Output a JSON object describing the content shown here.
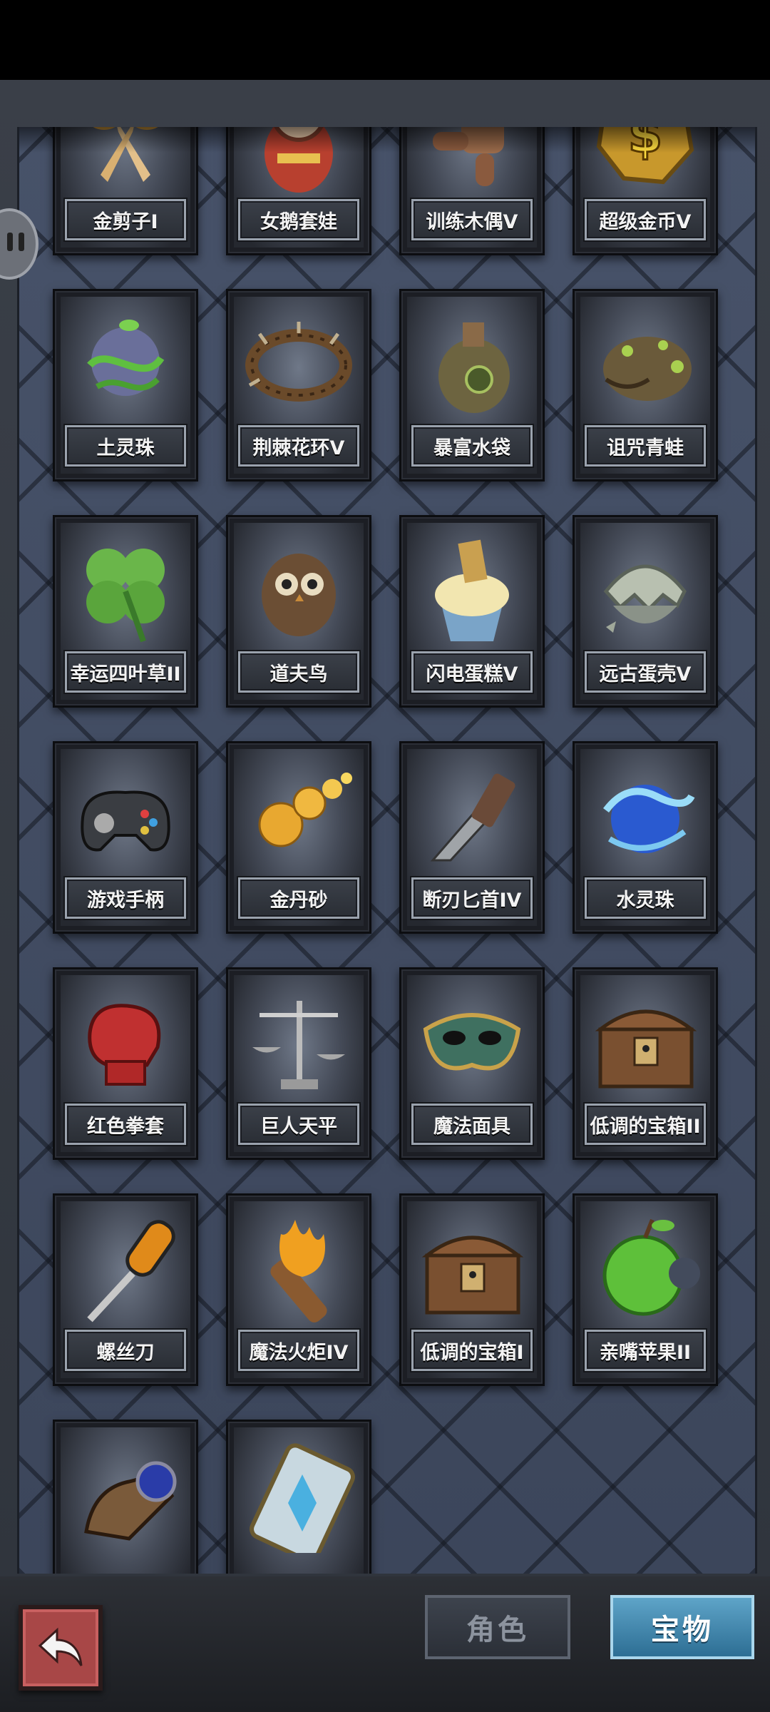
{
  "tabs": {
    "role": "角色",
    "treasure": "宝物"
  },
  "items": [
    {
      "name": "金剪子I",
      "icon": "golden-scissors-icon"
    },
    {
      "name": "女鹅套娃",
      "icon": "nesting-doll-icon"
    },
    {
      "name": "训练木偶V",
      "icon": "training-dummy-icon"
    },
    {
      "name": "超级金币V",
      "icon": "super-gold-coin-icon"
    },
    {
      "name": "土灵珠",
      "icon": "earth-orb-icon"
    },
    {
      "name": "荆棘花环V",
      "icon": "thorn-wreath-icon"
    },
    {
      "name": "暴富水袋",
      "icon": "water-flask-icon"
    },
    {
      "name": "诅咒青蛙",
      "icon": "cursed-frog-icon"
    },
    {
      "name": "幸运四叶草II",
      "icon": "four-leaf-clover-icon"
    },
    {
      "name": "道夫鸟",
      "icon": "owl-bird-icon"
    },
    {
      "name": "闪电蛋糕V",
      "icon": "lightning-cake-icon"
    },
    {
      "name": "远古蛋壳V",
      "icon": "ancient-eggshell-icon"
    },
    {
      "name": "游戏手柄",
      "icon": "gamepad-icon"
    },
    {
      "name": "金丹砂",
      "icon": "golden-pellets-icon"
    },
    {
      "name": "断刃匕首IV",
      "icon": "broken-dagger-icon"
    },
    {
      "name": "水灵珠",
      "icon": "water-orb-icon"
    },
    {
      "name": "红色拳套",
      "icon": "boxing-glove-icon"
    },
    {
      "name": "巨人天平",
      "icon": "balance-scale-icon"
    },
    {
      "name": "魔法面具",
      "icon": "magic-mask-icon"
    },
    {
      "name": "低调的宝箱II",
      "icon": "treasure-chest-icon"
    },
    {
      "name": "螺丝刀",
      "icon": "screwdriver-icon"
    },
    {
      "name": "魔法火炬IV",
      "icon": "magic-torch-icon"
    },
    {
      "name": "低调的宝箱I",
      "icon": "treasure-chest-icon"
    },
    {
      "name": "亲嘴苹果II",
      "icon": "bitten-apple-icon"
    },
    {
      "name": "",
      "icon": "armored-gauntlet-icon"
    },
    {
      "name": "",
      "icon": "crystal-card-icon"
    }
  ]
}
